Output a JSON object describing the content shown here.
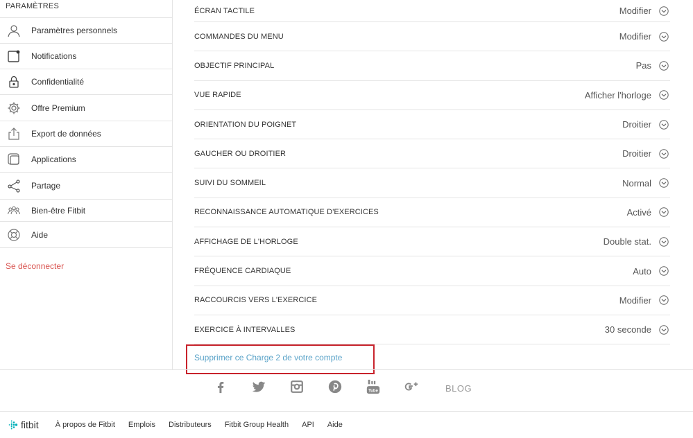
{
  "sidebar": {
    "title": "PARAMÈTRES",
    "items": [
      {
        "label": "Paramètres personnels",
        "icon": "user-icon"
      },
      {
        "label": "Notifications",
        "icon": "notification-icon"
      },
      {
        "label": "Confidentialité",
        "icon": "lock-icon"
      },
      {
        "label": "Offre Premium",
        "icon": "gear-icon"
      },
      {
        "label": "Export de données",
        "icon": "export-icon"
      },
      {
        "label": "Applications",
        "icon": "apps-icon"
      },
      {
        "label": "Partage",
        "icon": "share-icon"
      },
      {
        "label": "Bien-être Fitbit",
        "icon": "people-icon"
      },
      {
        "label": "Aide",
        "icon": "help-icon"
      }
    ],
    "logout": "Se déconnecter"
  },
  "settings": [
    {
      "name": "ÉCRAN TACTILE",
      "value": "Modifier"
    },
    {
      "name": "COMMANDES DU MENU",
      "value": "Modifier"
    },
    {
      "name": "OBJECTIF PRINCIPAL",
      "value": "Pas"
    },
    {
      "name": "VUE RAPIDE",
      "value": "Afficher l'horloge"
    },
    {
      "name": "ORIENTATION DU POIGNET",
      "value": "Droitier"
    },
    {
      "name": "GAUCHER OU DROITIER",
      "value": "Droitier"
    },
    {
      "name": "SUIVI DU SOMMEIL",
      "value": "Normal"
    },
    {
      "name": "RECONNAISSANCE AUTOMATIQUE D'EXERCICES",
      "value": "Activé"
    },
    {
      "name": "AFFICHAGE DE L'HORLOGE",
      "value": "Double stat."
    },
    {
      "name": "FRÉQUENCE CARDIAQUE",
      "value": "Auto"
    },
    {
      "name": "RACCOURCIS VERS L'EXERCICE",
      "value": "Modifier"
    },
    {
      "name": "EXERCICE À INTERVALLES",
      "value": "30 seconde"
    }
  ],
  "delete_link": "Supprimer ce Charge 2 de votre compte",
  "footer": {
    "social": [
      "facebook-icon",
      "twitter-icon",
      "instagram-icon",
      "pinterest-icon",
      "youtube-icon",
      "googleplus-icon"
    ],
    "blog": "BLOG",
    "brand": "fitbit",
    "links": [
      "À propos de Fitbit",
      "Emplois",
      "Distributeurs",
      "Fitbit Group Health",
      "API",
      "Aide"
    ]
  },
  "colors": {
    "accent_link": "#5aa3c8",
    "logout": "#d9534f",
    "highlight": "#c8232c",
    "brand_teal": "#00b0b9"
  }
}
